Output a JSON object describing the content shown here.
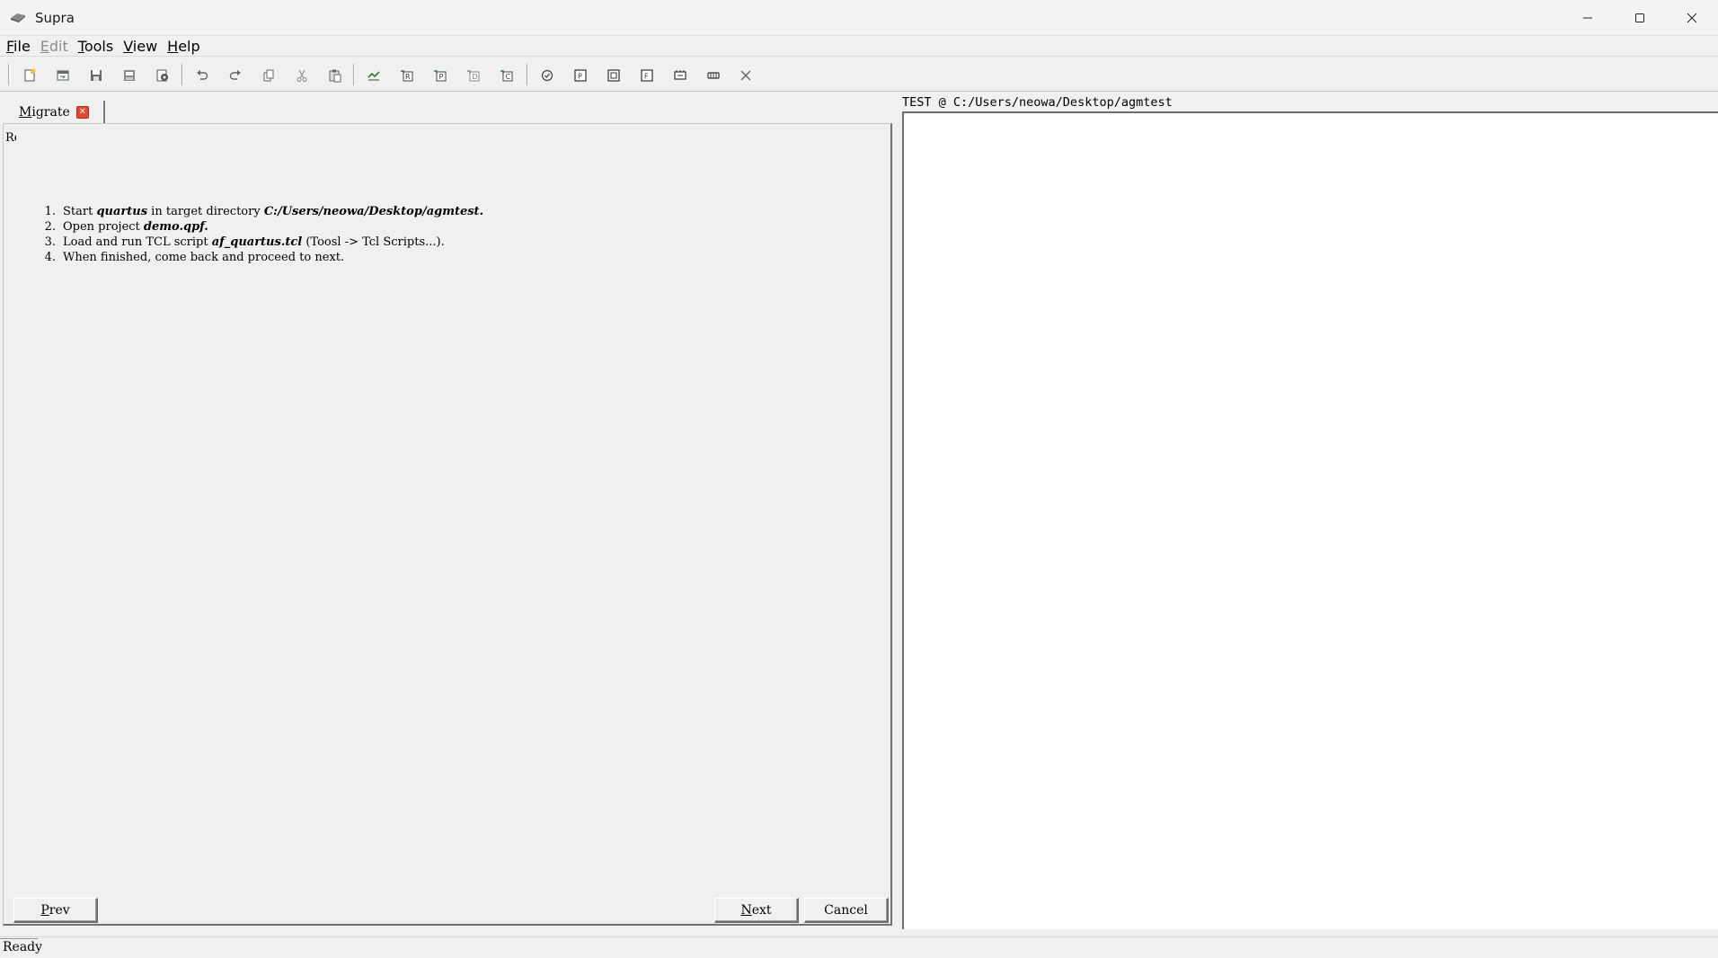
{
  "window": {
    "title": "Supra",
    "controls": [
      "minimize-icon",
      "maximize-icon",
      "close-icon"
    ]
  },
  "menu": {
    "items": [
      {
        "label_ul": "F",
        "label_rest": "ile",
        "enabled": true
      },
      {
        "label_ul": "E",
        "label_rest": "dit",
        "enabled": false
      },
      {
        "label_ul": "T",
        "label_rest": "ools",
        "enabled": true
      },
      {
        "label_ul": "V",
        "label_rest": "iew",
        "enabled": true
      },
      {
        "label_ul": "H",
        "label_rest": "elp",
        "enabled": true
      }
    ]
  },
  "toolbar": {
    "icons": [
      "new-file-icon",
      "open-icon",
      "save-icon",
      "save-as-icon",
      "settings-icon",
      "undo-icon",
      "redo-icon",
      "copy-icon",
      "cut-icon",
      "paste-icon",
      "run-icon",
      "build-r-icon",
      "build-p-icon",
      "build-d-icon",
      "build-c-icon",
      "check-icon",
      "view-p-icon",
      "view-grid-icon",
      "view-f-icon",
      "view-chip-icon",
      "view-bus-icon",
      "close-all-icon"
    ]
  },
  "tab": {
    "label_ul": "M",
    "label_rest": "igrate"
  },
  "left": {
    "fragment": "Re",
    "steps": [
      {
        "num": "1.",
        "parts": [
          {
            "t": "Start "
          },
          {
            "b": "quartus"
          },
          {
            "t": " in target directory "
          },
          {
            "b": "C:/Users/neowa/Desktop/agmtest."
          }
        ]
      },
      {
        "num": "2.",
        "parts": [
          {
            "t": "Open project "
          },
          {
            "b": "demo.qpf."
          }
        ]
      },
      {
        "num": "3.",
        "parts": [
          {
            "t": "Load and run TCL script "
          },
          {
            "b": "af_quartus.tcl"
          },
          {
            "t": " (Toosl -> Tcl Scripts...)."
          }
        ]
      },
      {
        "num": "4.",
        "parts": [
          {
            "t": "When finished, come back and proceed to next."
          }
        ]
      }
    ],
    "buttons": {
      "prev_ul": "P",
      "prev_rest": "rev",
      "next_ul": "N",
      "next_rest": "ext",
      "cancel": "Cancel"
    }
  },
  "right": {
    "header": "TEST @ C:/Users/neowa/Desktop/agmtest"
  },
  "status": {
    "text": "Ready"
  }
}
